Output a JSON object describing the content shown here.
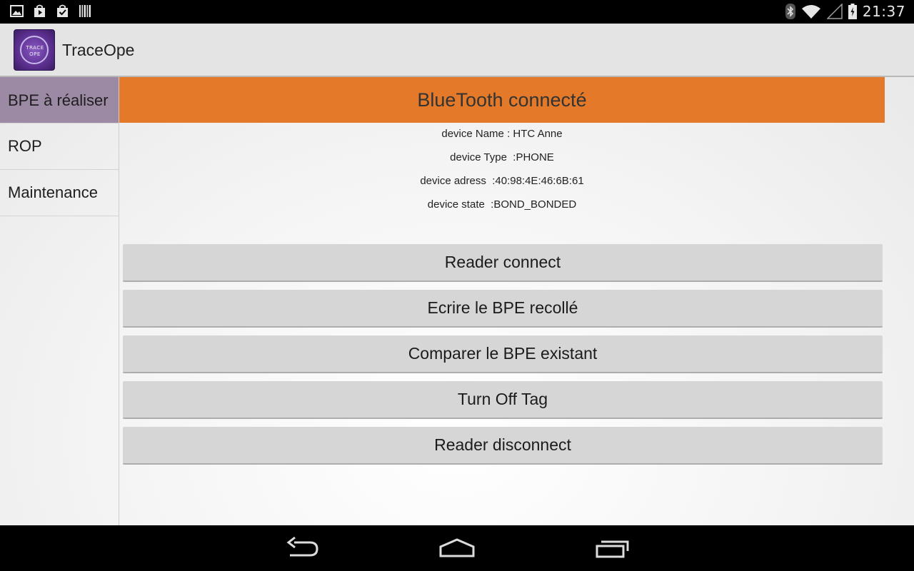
{
  "status_bar": {
    "time": "21:37",
    "left_icons": [
      "image-icon",
      "play-store-icon",
      "task-icon",
      "barcode-icon"
    ],
    "right_icons": [
      "bluetooth-icon",
      "wifi-icon",
      "signal-icon",
      "battery-icon"
    ]
  },
  "app": {
    "title": "TraceOpe",
    "icon_text_top": "TRACE",
    "icon_text_bottom": "OPE"
  },
  "sidebar": {
    "items": [
      {
        "label": "BPE à réaliser",
        "active": true
      },
      {
        "label": "ROP",
        "active": false
      },
      {
        "label": "Maintenance",
        "active": false
      }
    ]
  },
  "main": {
    "header": "BlueTooth connecté",
    "device_info": [
      {
        "label": "device Name",
        "sep": " : ",
        "value": "HTC Anne"
      },
      {
        "label": "device Type",
        "sep": "  :",
        "value": "PHONE"
      },
      {
        "label": "device adress",
        "sep": "  :",
        "value": "40:98:4E:46:6B:61"
      },
      {
        "label": "device state",
        "sep": "  :",
        "value": "BOND_BONDED"
      }
    ],
    "buttons": [
      "Reader connect",
      "Ecrire le BPE recollé",
      "Comparer le BPE existant",
      "Turn Off Tag",
      "Reader disconnect"
    ]
  },
  "nav_bar": {
    "buttons": [
      "back-icon",
      "home-icon",
      "recent-apps-icon"
    ]
  },
  "colors": {
    "header_orange": "#e47a29",
    "sidebar_active": "#9c8aa5",
    "button_gray": "#d6d6d6",
    "action_bar": "#e4e4e4"
  }
}
